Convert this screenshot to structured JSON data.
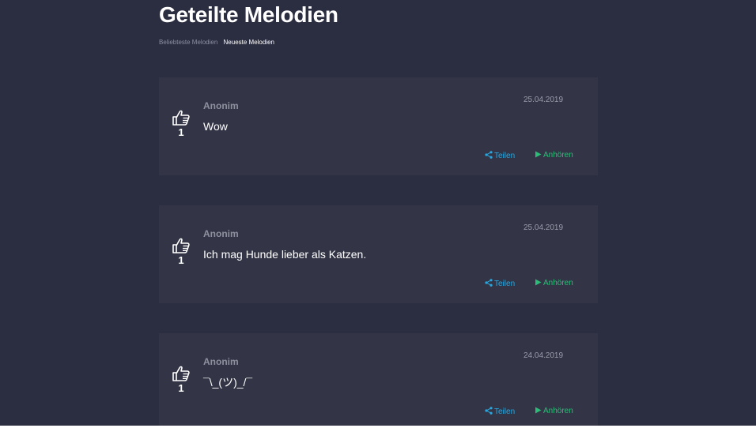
{
  "page": {
    "title": "Geteilte Melodien"
  },
  "tabs": [
    {
      "label": "Beliebteste Melodien",
      "active": false
    },
    {
      "label": "Neueste Melodien",
      "active": true
    }
  ],
  "melodies": [
    {
      "likes": "1",
      "author": "Anonim",
      "date": "25.04.2019",
      "message": "Wow",
      "share_label": "Teilen",
      "listen_label": "Anhören"
    },
    {
      "likes": "1",
      "author": "Anonim",
      "date": "25.04.2019",
      "message": "Ich mag Hunde lieber als Katzen.",
      "share_label": "Teilen",
      "listen_label": "Anhören"
    },
    {
      "likes": "1",
      "author": "Anonim",
      "date": "24.04.2019",
      "message": "¯\\_(ツ)_/¯",
      "share_label": "Teilen",
      "listen_label": "Anhören"
    }
  ],
  "icons": {
    "like": "thumbs-up-icon",
    "share": "share-icon",
    "listen": "play-icon"
  },
  "colors": {
    "background": "#2b2d40",
    "card": "#333546",
    "share": "#29a8e0",
    "listen": "#2bbd77",
    "author": "#8e909f"
  }
}
